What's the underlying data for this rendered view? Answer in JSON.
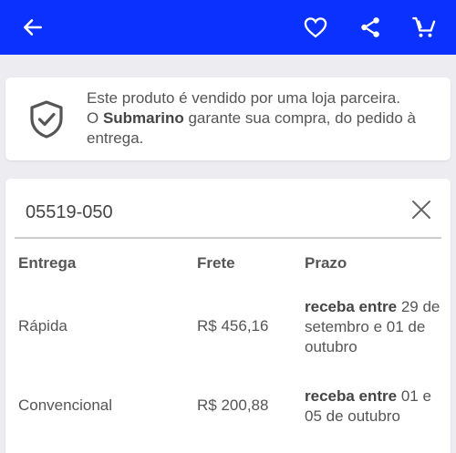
{
  "header": {
    "back_icon": "arrow-left-icon",
    "actions": [
      "heart-icon",
      "share-icon",
      "cart-icon"
    ],
    "color": "#0b31ff"
  },
  "seller_notice": {
    "line1": "Este produto é vendido por uma loja parceira.",
    "prefix": "O ",
    "brand": "Submarino",
    "suffix": " garante sua compra, do pedido à entrega."
  },
  "shipping": {
    "cep_value": "05519-050",
    "columns": {
      "entrega": "Entrega",
      "frete": "Frete",
      "prazo": "Prazo"
    },
    "rows": [
      {
        "type": "Rápida",
        "price": "R$ 456,16",
        "prazo_label": "receba entre",
        "prazo_value": " 29 de setembro e 01 de outubro"
      },
      {
        "type": "Convencional",
        "price": "R$ 200,88",
        "prazo_label": "receba entre",
        "prazo_value": " 01 e 05 de outubro"
      }
    ]
  }
}
